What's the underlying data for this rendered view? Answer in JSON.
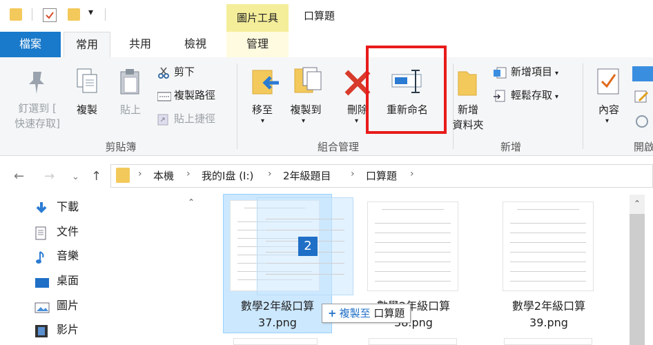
{
  "title_bar": {
    "context_tab": "圖片工具",
    "window_title": "口算題"
  },
  "tabs": [
    {
      "label": "檔案"
    },
    {
      "label": "常用"
    },
    {
      "label": "共用"
    },
    {
      "label": "檢視"
    },
    {
      "label": "管理"
    }
  ],
  "ribbon": {
    "clipboard": {
      "pin_label_1": "釘選到 [",
      "pin_label_2": "快速存取]",
      "copy": "複製",
      "paste": "貼上",
      "cut": "剪下",
      "copy_path": "複製路徑",
      "paste_shortcut": "貼上捷徑",
      "group": "剪貼簿"
    },
    "organize": {
      "move_to": "移至",
      "copy_to": "複製到",
      "delete": "刪除",
      "rename": "重新命名",
      "group": "組合管理"
    },
    "new": {
      "new_folder_1": "新增",
      "new_folder_2": "資料夾",
      "new_item": "新增項目",
      "easy_access": "輕鬆存取",
      "group": "新增"
    },
    "open": {
      "properties": "內容",
      "group": "開啟"
    }
  },
  "address_bar": {
    "crumbs": [
      "本機",
      "我的I盘 (I:)",
      "2年級題目",
      "口算題"
    ]
  },
  "nav_pane": {
    "items": [
      "下載",
      "文件",
      "音樂",
      "桌面",
      "圖片",
      "影片"
    ]
  },
  "files": [
    {
      "name_line1": "數學2年級口算",
      "name_line2": "37.png"
    },
    {
      "name_line1": "數學2年級口算",
      "name_line2": "38.png"
    },
    {
      "name_line1": "數學2年級口算",
      "name_line2": "39.png"
    }
  ],
  "drag": {
    "count": "2",
    "tooltip_prefix": "複製至",
    "tooltip_target": "口算題"
  },
  "colors": {
    "file_tab": "#1979ca",
    "context_tab": "#f4ee9a",
    "highlight": "#e81b1b",
    "selection": "#cce8ff"
  }
}
